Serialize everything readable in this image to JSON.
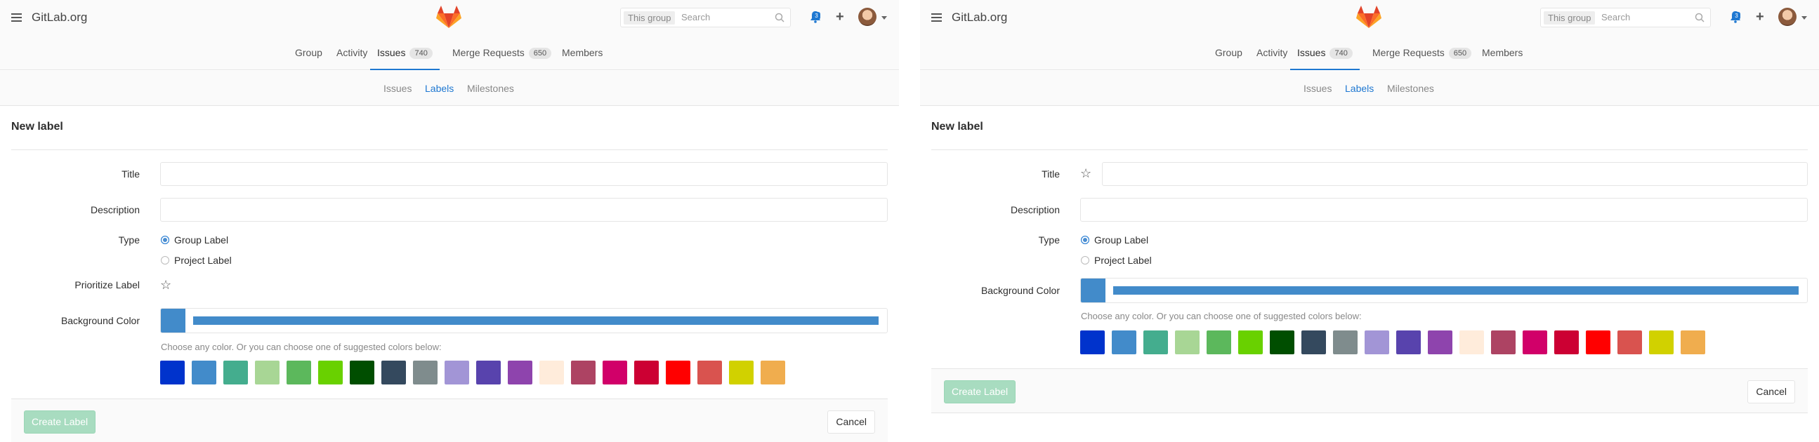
{
  "header": {
    "site_name": "GitLab.org",
    "search_scope": "This group",
    "search_placeholder": "Search",
    "notification_count": "3"
  },
  "nav": {
    "items": [
      {
        "label": "Group",
        "count": ""
      },
      {
        "label": "Activity",
        "count": ""
      },
      {
        "label": "Issues",
        "count": "740",
        "active": true
      },
      {
        "label": "Merge Requests",
        "count": "650"
      },
      {
        "label": "Members",
        "count": ""
      }
    ]
  },
  "subnav": {
    "items": [
      {
        "label": "Issues"
      },
      {
        "label": "Labels",
        "active": true
      },
      {
        "label": "Milestones"
      }
    ]
  },
  "form": {
    "page_title": "New label",
    "title_label": "Title",
    "description_label": "Description",
    "type_label": "Type",
    "type_options": [
      "Group Label",
      "Project Label"
    ],
    "type_selected": "Group Label",
    "prioritize_label": "Prioritize Label",
    "background_color_label": "Background Color",
    "selected_color": "#428bca",
    "hint": "Choose any color. Or you can choose one of suggested colors below:",
    "suggested_colors": [
      "#0033cc",
      "#428bca",
      "#44ad8e",
      "#a8d695",
      "#5cb85c",
      "#69d100",
      "#004e00",
      "#34495e",
      "#7f8c8d",
      "#a295d6",
      "#5843ad",
      "#8e44ad",
      "#ffecdb",
      "#ad4363",
      "#d10069",
      "#cc0033",
      "#ff0000",
      "#d9534f",
      "#d1d100",
      "#f0ad4e"
    ],
    "create_button": "Create Label",
    "cancel_button": "Cancel"
  },
  "colors": {
    "accent": "#1f78d1",
    "create_button_bg": "#a8dcc0"
  },
  "icons": {
    "menu": "hamburger-icon",
    "logo": "gitlab-tanuki-logo",
    "search": "search-icon",
    "notifications": "bell-icon",
    "new": "plus-icon",
    "star": "star-icon"
  }
}
